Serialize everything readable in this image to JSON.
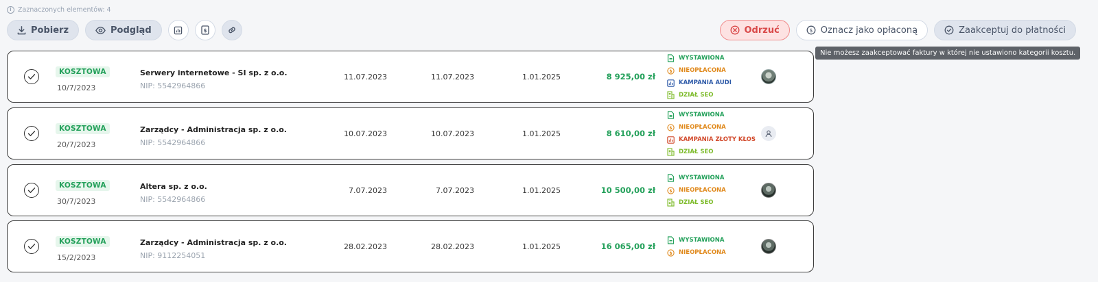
{
  "selection": {
    "text": "Zaznaczonych elementów: 4"
  },
  "toolbar": {
    "download_label": "Pobierz",
    "preview_label": "Podgląd",
    "reject_label": "Odrzuć",
    "mark_paid_label": "Oznacz jako opłaconą",
    "accept_label": "Zaakceptuj do płatności"
  },
  "tooltip": {
    "text": "Nie możesz zaakceptować faktury w której nie ustawiono kategorii kosztu."
  },
  "colors": {
    "green": "#23a05a",
    "orange": "#e08a1e",
    "blue": "#2e5aa8",
    "lime": "#7dbb2a",
    "red": "#d24a2c",
    "reject": "#d94848"
  },
  "rows": [
    {
      "type": "KOSZTOWA",
      "issue_date": "10/7/2023",
      "company": "Serwery internetowe - SI sp. z o.o.",
      "nip": "NIP: 5542964866",
      "date1": "11.07.2023",
      "date2": "11.07.2023",
      "date3": "1.01.2025",
      "amount": "8 925,00 zł",
      "tags": [
        {
          "label": "WYSTAWIONA",
          "color": "green",
          "icon": "document-icon"
        },
        {
          "label": "NIEOPŁACONA",
          "color": "orange",
          "icon": "coin-icon"
        },
        {
          "label": "KAMPANIA AUDI",
          "color": "blue",
          "icon": "bar-chart-icon"
        },
        {
          "label": "DZIAŁ SEO",
          "color": "lime",
          "icon": "department-icon"
        }
      ],
      "avatar": "photo"
    },
    {
      "type": "KOSZTOWA",
      "issue_date": "20/7/2023",
      "company": "Zarządcy - Administracja sp. z o.o.",
      "nip": "NIP: 5542964866",
      "date1": "10.07.2023",
      "date2": "10.07.2023",
      "date3": "1.01.2025",
      "amount": "8 610,00 zł",
      "tags": [
        {
          "label": "WYSTAWIONA",
          "color": "green",
          "icon": "document-icon"
        },
        {
          "label": "NIEOPŁACONA",
          "color": "orange",
          "icon": "coin-icon"
        },
        {
          "label": "KAMPANIA ZŁOTY KŁOS",
          "color": "red",
          "icon": "bar-chart-icon"
        },
        {
          "label": "DZIAŁ SEO",
          "color": "lime",
          "icon": "department-icon"
        }
      ],
      "avatar": "placeholder"
    },
    {
      "type": "KOSZTOWA",
      "issue_date": "30/7/2023",
      "company": "Altera sp. z o.o.",
      "nip": "NIP: 5542964866",
      "date1": "7.07.2023",
      "date2": "7.07.2023",
      "date3": "1.01.2025",
      "amount": "10 500,00 zł",
      "tags": [
        {
          "label": "WYSTAWIONA",
          "color": "green",
          "icon": "document-icon"
        },
        {
          "label": "NIEOPŁACONA",
          "color": "orange",
          "icon": "coin-icon"
        },
        {
          "label": "DZIAŁ SEO",
          "color": "lime",
          "icon": "department-icon"
        }
      ],
      "avatar": "photo2"
    },
    {
      "type": "KOSZTOWA",
      "issue_date": "15/2/2023",
      "company": "Zarządcy - Administracja sp. z o.o.",
      "nip": "NIP: 9112254051",
      "date1": "28.02.2023",
      "date2": "28.02.2023",
      "date3": "1.01.2025",
      "amount": "16 065,00 zł",
      "tags": [
        {
          "label": "WYSTAWIONA",
          "color": "green",
          "icon": "document-icon"
        },
        {
          "label": "NIEOPŁACONA",
          "color": "orange",
          "icon": "coin-icon"
        }
      ],
      "avatar": "photo2"
    }
  ]
}
